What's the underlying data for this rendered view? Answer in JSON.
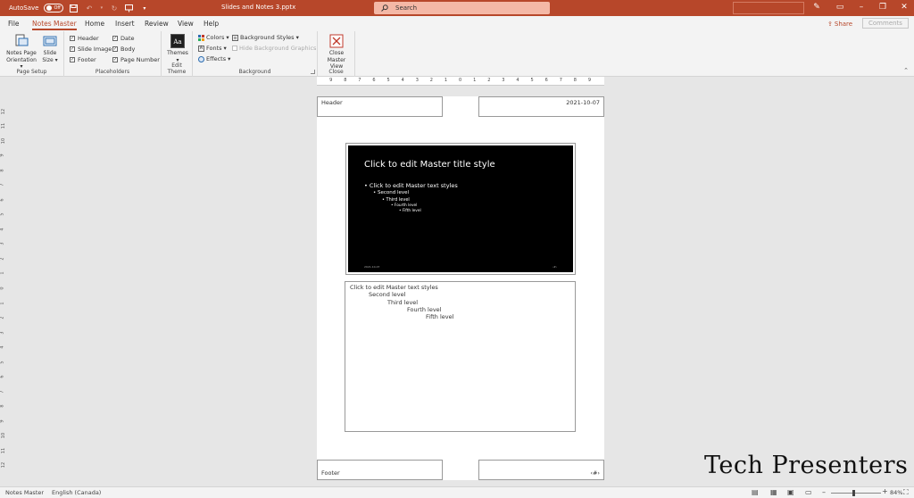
{
  "titlebar": {
    "autosave_label": "AutoSave",
    "autosave_state": "Off",
    "doc_title": "Slides and Notes 3.pptx",
    "search_placeholder": "Search",
    "accent": "#b7472a"
  },
  "tabs": [
    {
      "label": "File"
    },
    {
      "label": "Notes Master",
      "active": true
    },
    {
      "label": "Home"
    },
    {
      "label": "Insert"
    },
    {
      "label": "Review"
    },
    {
      "label": "View"
    },
    {
      "label": "Help"
    }
  ],
  "share_label": "Share",
  "comments_label": "Comments",
  "ribbon": {
    "page_setup": {
      "orientation_l1": "Notes Page",
      "orientation_l2": "Orientation",
      "size_l1": "Slide",
      "size_l2": "Size",
      "label": "Page Setup"
    },
    "placeholders": {
      "header": "Header",
      "slide_image": "Slide Image",
      "footer": "Footer",
      "date": "Date",
      "body": "Body",
      "page_number": "Page Number",
      "label": "Placeholders"
    },
    "edit_theme": {
      "themes": "Themes",
      "label": "Edit Theme"
    },
    "background": {
      "colors": "Colors",
      "fonts": "Fonts",
      "effects": "Effects",
      "background_styles": "Background Styles",
      "hide_graphics": "Hide Background Graphics",
      "label": "Background"
    },
    "close": {
      "l1": "Close",
      "l2": "Master View",
      "label": "Close"
    }
  },
  "ruler": {
    "top": [
      "9",
      "8",
      "7",
      "6",
      "5",
      "4",
      "3",
      "2",
      "1",
      "0",
      "1",
      "2",
      "3",
      "4",
      "5",
      "6",
      "7",
      "8",
      "9"
    ],
    "left": [
      "12",
      "11",
      "10",
      "9",
      "8",
      "7",
      "6",
      "5",
      "4",
      "3",
      "2",
      "1",
      "0",
      "1",
      "2",
      "3",
      "4",
      "5",
      "6",
      "7",
      "8",
      "9",
      "10",
      "11",
      "12"
    ]
  },
  "notes_page": {
    "header": "Header",
    "date": "2021-10-07",
    "footer": "Footer",
    "page_number": "‹#›",
    "slide": {
      "title": "Click to edit Master title style",
      "levels": [
        "Click to edit Master text styles",
        "Second level",
        "Third level",
        "Fourth level",
        "Fifth level"
      ],
      "footer_date": "2021-10-07",
      "footer_num": "‹#›"
    },
    "body": {
      "levels": [
        "Click to edit Master text styles",
        "Second level",
        "Third level",
        "Fourth level",
        "Fifth level"
      ]
    }
  },
  "statusbar": {
    "view": "Notes Master",
    "language": "English (Canada)",
    "zoom": "84%"
  },
  "watermark": "Tech Presenters"
}
